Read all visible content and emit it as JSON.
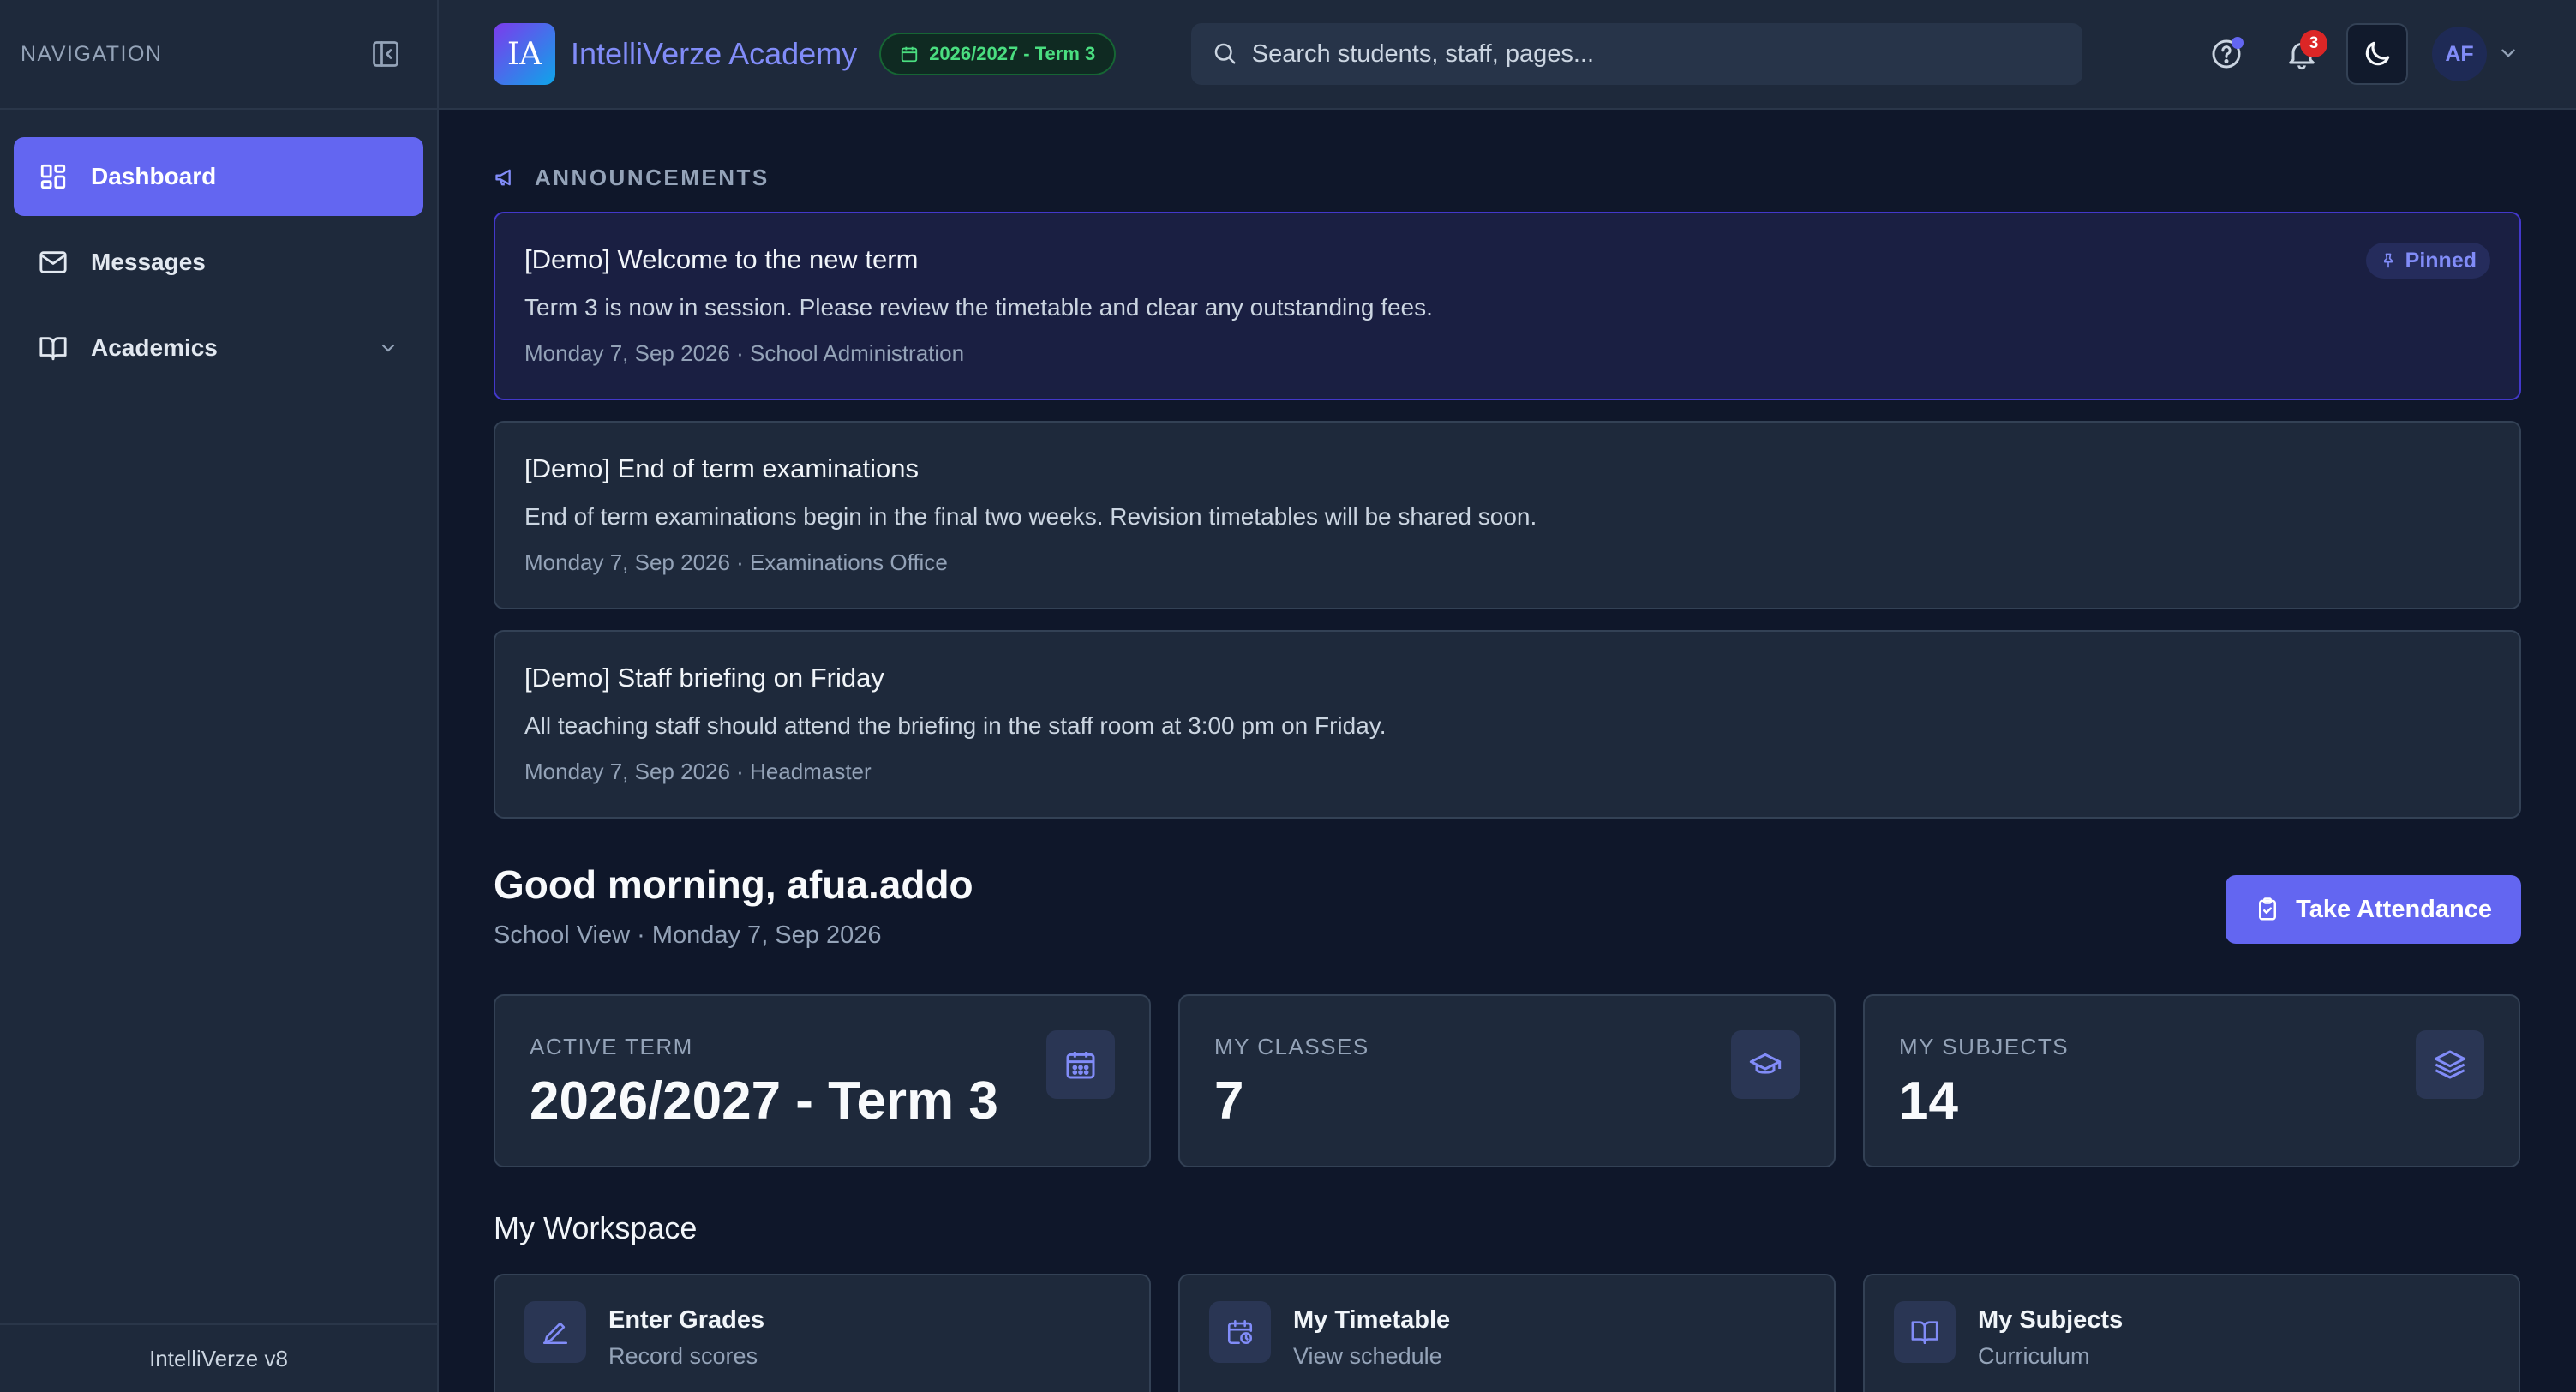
{
  "sidebar": {
    "heading": "NAVIGATION",
    "items": [
      {
        "label": "Dashboard",
        "icon": "dashboard-grid-icon"
      },
      {
        "label": "Messages",
        "icon": "mail-icon"
      },
      {
        "label": "Academics",
        "icon": "book-icon"
      }
    ],
    "footer": "IntelliVerze v8"
  },
  "header": {
    "logo_text": "IA",
    "brand": "IntelliVerze Academy",
    "term_chip": "2026/2027 - Term 3",
    "search_placeholder": "Search students, staff, pages...",
    "notification_count": "3",
    "avatar_initials": "AF"
  },
  "announcements": {
    "heading": "ANNOUNCEMENTS",
    "items": [
      {
        "title": "[Demo] Welcome to the new term",
        "body": "Term 3 is now in session. Please review the timetable and clear any outstanding fees.",
        "meta": "Monday 7, Sep 2026 · School Administration",
        "pinned_label": "Pinned"
      },
      {
        "title": "[Demo] End of term examinations",
        "body": "End of term examinations begin in the final two weeks. Revision timetables will be shared soon.",
        "meta": "Monday 7, Sep 2026 · Examinations Office"
      },
      {
        "title": "[Demo] Staff briefing on Friday",
        "body": "All teaching staff should attend the briefing in the staff room at 3:00 pm on Friday.",
        "meta": "Monday 7, Sep 2026 · Headmaster"
      }
    ]
  },
  "greeting": {
    "title": "Good morning, afua.addo",
    "subtitle": "School View · Monday 7, Sep 2026",
    "action_label": "Take Attendance"
  },
  "stats": [
    {
      "label": "ACTIVE TERM",
      "value": "2026/2027 - Term 3",
      "icon": "calendar-icon"
    },
    {
      "label": "MY CLASSES",
      "value": "7",
      "icon": "graduation-cap-icon"
    },
    {
      "label": "MY SUBJECTS",
      "value": "14",
      "icon": "layers-icon"
    }
  ],
  "workspace": {
    "title": "My Workspace",
    "items": [
      {
        "title": "Enter Grades",
        "subtitle": "Record scores",
        "icon": "pencil-icon"
      },
      {
        "title": "My Timetable",
        "subtitle": "View schedule",
        "icon": "calendar-clock-icon"
      },
      {
        "title": "My Subjects",
        "subtitle": "Curriculum",
        "icon": "book-open-icon"
      }
    ]
  },
  "colors": {
    "accent": "#6366f1",
    "background": "#0f172a",
    "surface": "#1e293b",
    "success": "#4ade80",
    "danger": "#dc2626"
  }
}
